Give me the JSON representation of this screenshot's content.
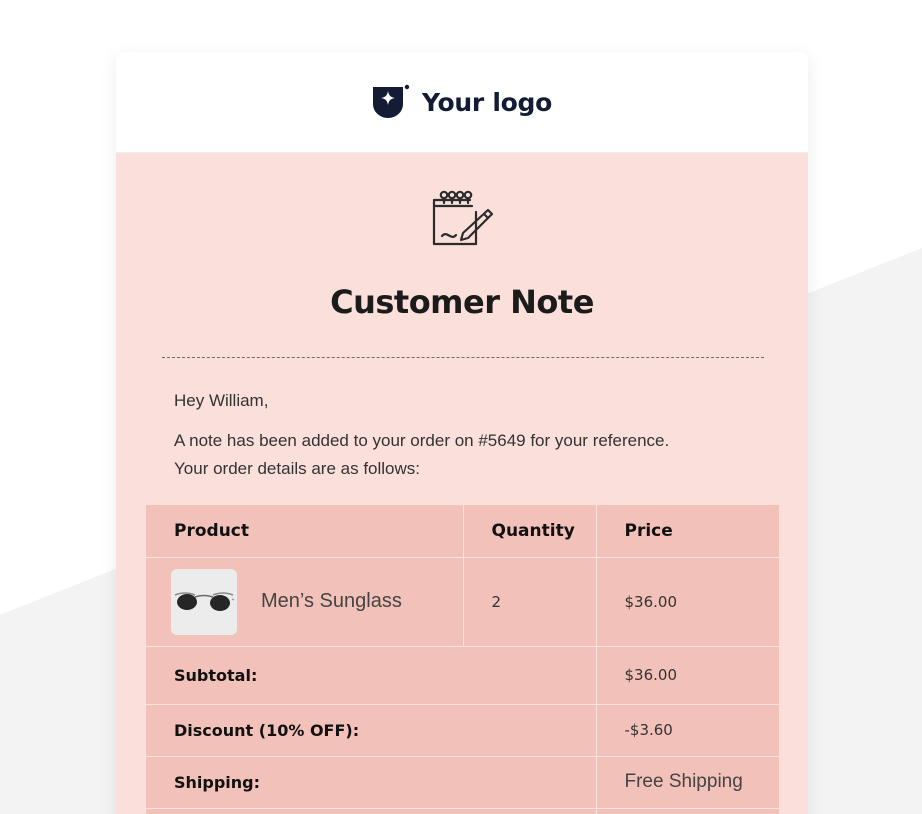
{
  "brand": {
    "logo_text": "Your logo"
  },
  "email": {
    "title": "Customer Note",
    "greeting": "Hey William,",
    "line1": "A note has been added to your order on #5649 for your reference.",
    "line2": "Your order details are as follows:"
  },
  "table": {
    "headers": {
      "product": "Product",
      "quantity": "Quantity",
      "price": "Price"
    },
    "items": [
      {
        "name": "Men’s Sunglass",
        "quantity": "2",
        "price": "$36.00"
      }
    ],
    "totals": [
      {
        "label": "Subtotal:",
        "value": "$36.00"
      },
      {
        "label": "Discount (10% OFF):",
        "value": "-$3.60"
      },
      {
        "label": "Shipping:",
        "value": "Free Shipping"
      }
    ]
  },
  "colors": {
    "card_bg": "#fadfdb",
    "table_bg": "#f2c1b9",
    "brand_dark": "#141b34",
    "page_grey": "#f3f3f3"
  },
  "icons": {
    "logo": "shield-sparkle-icon",
    "note": "notepad-pencil-icon",
    "product": "sunglasses-icon"
  }
}
